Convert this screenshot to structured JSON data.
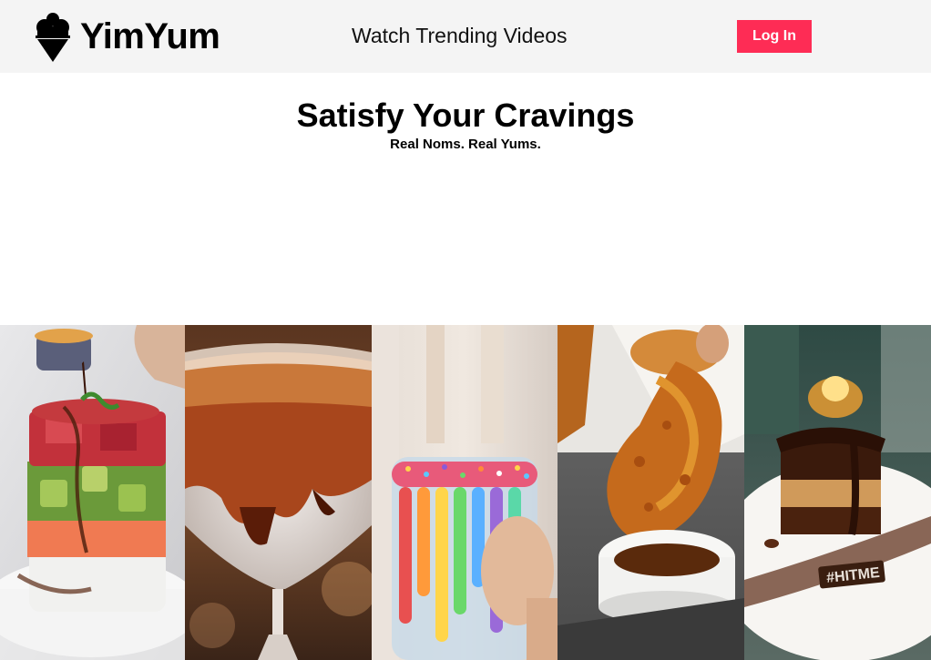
{
  "header": {
    "brand": "YimYum",
    "logo_icon": "ice-cream-cone-icon",
    "nav_link": "Watch Trending Videos",
    "login_label": "Log In",
    "accent_color": "#fe2c55"
  },
  "hero": {
    "title": "Satisfy Your Cravings",
    "subtitle": "Real Noms. Real Yums."
  },
  "videos": [
    {
      "subject": "poke tower with sauce pour",
      "icon": "video-thumbnail"
    },
    {
      "subject": "cocktail glass with chocolate and coconut rim",
      "icon": "video-thumbnail"
    },
    {
      "subject": "rainbow drip milkshake jar with sprinkles",
      "icon": "video-thumbnail"
    },
    {
      "subject": "fried chicken drumstick dipped in sauce",
      "icon": "video-thumbnail"
    },
    {
      "subject": "layered chocolate cake with flambé",
      "icon": "video-thumbnail",
      "plate_text": "#HITME"
    }
  ]
}
